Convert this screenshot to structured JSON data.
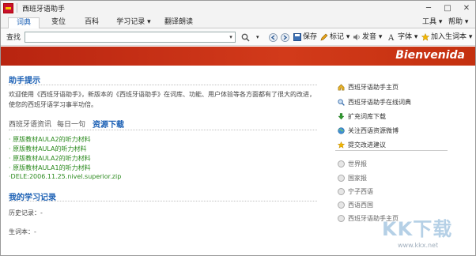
{
  "window": {
    "title": "西班牙语助手",
    "controls": [
      "─",
      "□",
      "✕"
    ]
  },
  "tabs": [
    {
      "label": "词典",
      "active": true
    },
    {
      "label": "变位",
      "active": false
    },
    {
      "label": "百科",
      "active": false
    },
    {
      "label": "学习记录 ▾",
      "active": false
    },
    {
      "label": "翻译朗读",
      "active": false
    }
  ],
  "right_menu": {
    "tools": "工具 ▾",
    "help": "帮助 ▾"
  },
  "toolbar": {
    "search_label": "查找",
    "search_value": "",
    "search_drop": "▾",
    "zoom_drop": "▾",
    "save": "保存",
    "mark": "标记 ▾",
    "speak": "发音 ▾",
    "font": "字体 ▾",
    "add_word": "加入生词本 ▾"
  },
  "banner": {
    "text": "Bienvenida",
    "color": "#c4300f"
  },
  "help": {
    "title": "助手提示",
    "text": "欢迎使用《西班牙语助手》，新版本的《西班牙语助手》在词库、功能、用户体验等各方面都有了很大的改进，使您的西班牙语学习事半功倍。"
  },
  "subtabs": [
    {
      "label": "西班牙语资讯",
      "active": false
    },
    {
      "label": "每日一句",
      "active": false
    },
    {
      "label": "资源下载",
      "active": true
    }
  ],
  "downloads": [
    "· 原版教材AULA2的听力材料",
    "· 原版教材AULA的听力材料",
    "· 原版教材AULA2的听力材料",
    "· 原版教材AULA1的听力材料",
    "·DELE:2006.11.25.nivel.superior.zip"
  ],
  "records": {
    "title": "我的学习记录",
    "history": "历史记录：-",
    "vocab": "生词本：-"
  },
  "right_links": [
    {
      "label": "西班牙语助手主页",
      "icon": "home-icon"
    },
    {
      "label": "西班牙语助手在线词典",
      "icon": "search-icon"
    },
    {
      "label": "扩充词库下载",
      "icon": "download-icon"
    },
    {
      "label": "关注西语资源微博",
      "icon": "globe-icon"
    },
    {
      "label": "提交改进建议",
      "icon": "star-icon"
    }
  ],
  "right_radios": [
    "世界报",
    "国家报",
    "宁子西语",
    "西语西国",
    "西班牙语助手主页"
  ],
  "watermark": {
    "logo": "KK下载",
    "url": "www.kkx.net"
  }
}
